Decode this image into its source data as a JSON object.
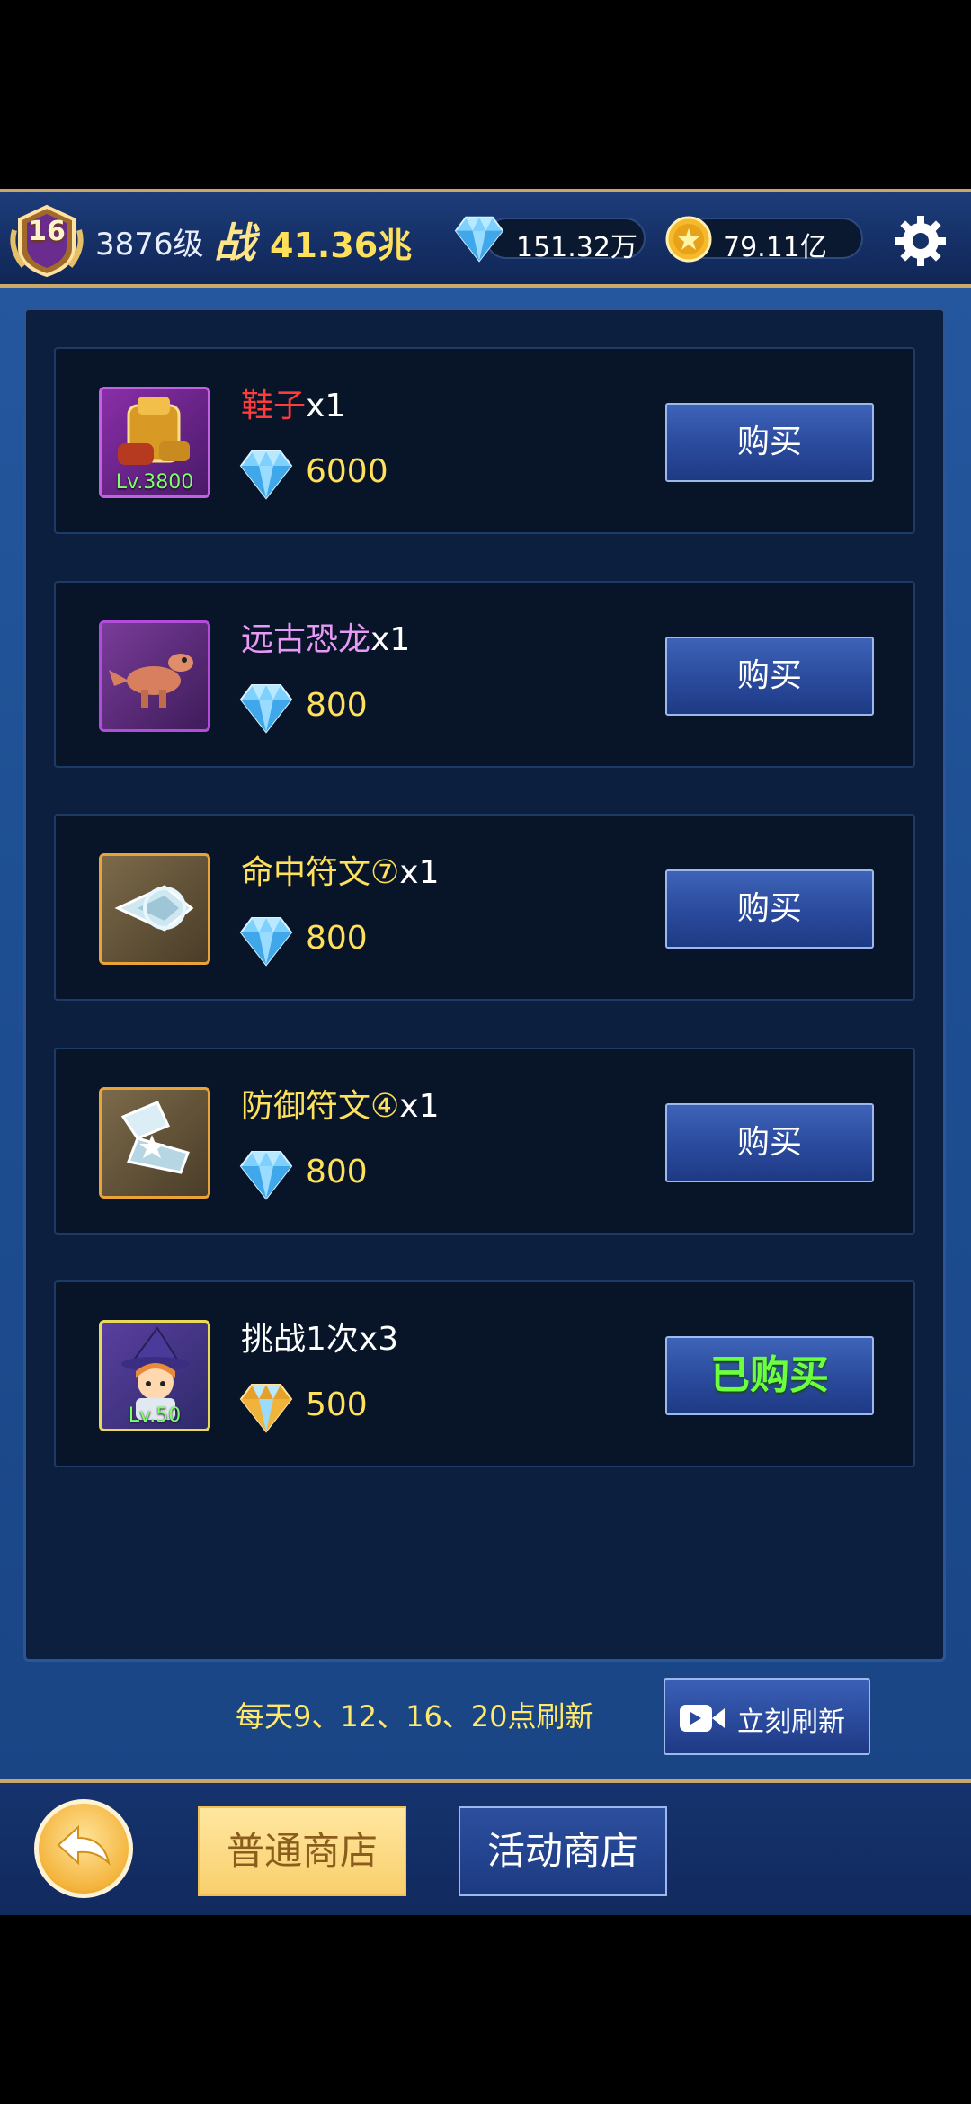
{
  "header": {
    "rank_badge": "16",
    "player_level": "3876级",
    "power_icon_char": "战",
    "power_value": "41.36兆",
    "gems": "151.32万",
    "coins": "79.11亿"
  },
  "shop_items": [
    {
      "name": "鞋子",
      "name_color": "#ff3b3b",
      "qty": "x1",
      "price": "6000",
      "price_icon": "diamond-icon",
      "level_label": "Lv.3800",
      "button": "购买",
      "bought": false,
      "thumb_icon": "golden-armor-icon",
      "frame_color": "#c163e0"
    },
    {
      "name": "远古恐龙",
      "name_color": "#e79af5",
      "qty": "x1",
      "price": "800",
      "price_icon": "diamond-icon",
      "level_label": "",
      "button": "购买",
      "bought": false,
      "thumb_icon": "dinosaur-icon",
      "frame_color": "#b24ddb"
    },
    {
      "name": "命中符文⑦",
      "name_color": "#ffe05a",
      "qty": "x1",
      "price": "800",
      "price_icon": "diamond-icon",
      "level_label": "",
      "button": "购买",
      "bought": false,
      "thumb_icon": "hit-rune-icon",
      "frame_color": "#e9a338"
    },
    {
      "name": "防御符文④",
      "name_color": "#ffe05a",
      "qty": "x1",
      "price": "800",
      "price_icon": "diamond-icon",
      "level_label": "",
      "button": "购买",
      "bought": false,
      "thumb_icon": "defense-rune-icon",
      "frame_color": "#e9a338"
    },
    {
      "name": "挑战1次",
      "name_color": "#ffffff",
      "qty": "x3",
      "price": "500",
      "price_icon": "gold-diamond-icon",
      "level_label": "Lv.50",
      "button": "已购买",
      "bought": true,
      "thumb_icon": "witch-girl-icon",
      "frame_color": "#e8d95b"
    }
  ],
  "refresh": {
    "schedule_text": "每天9、12、16、20点刷新",
    "button_label": "立刻刷新"
  },
  "bottom_tabs": {
    "normal_shop": "普通商店",
    "event_shop": "活动商店"
  }
}
